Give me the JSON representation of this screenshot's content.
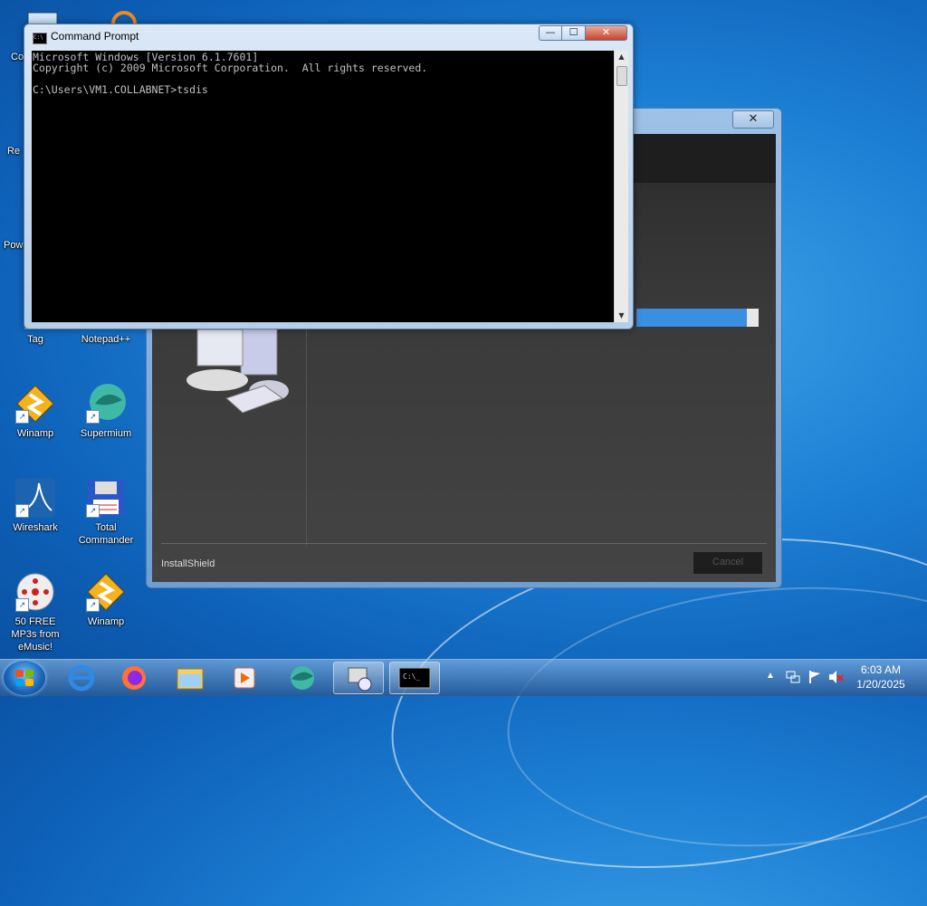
{
  "desktop": {
    "icons": [
      {
        "label": "Co",
        "icon": "computer-icon"
      },
      {
        "label": "Re",
        "icon": "recycle-bin-icon"
      },
      {
        "label": "Pow",
        "icon": "powershell-icon"
      },
      {
        "label": "Tag",
        "icon": "tag-app-icon"
      },
      {
        "label": "Notepad++",
        "icon": "notepadpp-icon"
      },
      {
        "label": "Winamp",
        "icon": "winamp-icon"
      },
      {
        "label": "Supermium",
        "icon": "supermium-icon"
      },
      {
        "label": "Wireshark",
        "icon": "wireshark-icon"
      },
      {
        "label": "Total Commander",
        "icon": "total-commander-icon"
      },
      {
        "label": "50 FREE MP3s from eMusic!",
        "icon": "emusic-icon"
      },
      {
        "label": "Winamp",
        "icon": "winamp-icon"
      }
    ]
  },
  "cmd": {
    "title": "Command Prompt",
    "console_text": "Microsoft Windows [Version 6.1.7601]\nCopyright (c) 2009 Microsoft Corporation.  All rights reserved.\n\nC:\\Users\\VM1.COLLABNET>tsdis",
    "buttons": {
      "minimize": "—",
      "maximize": "☐",
      "close": "✕"
    }
  },
  "installer": {
    "brand": "InstallShield",
    "cancel_label": "Cancel",
    "close": "✕",
    "progress": 0.9
  },
  "taskbar": {
    "time": "6:03 AM",
    "date": "1/20/2025",
    "apps": [
      "internet-explorer-icon",
      "firefox-icon",
      "file-explorer-icon",
      "media-player-icon",
      "supermium-icon",
      "installer-icon",
      "command-prompt-icon"
    ]
  }
}
